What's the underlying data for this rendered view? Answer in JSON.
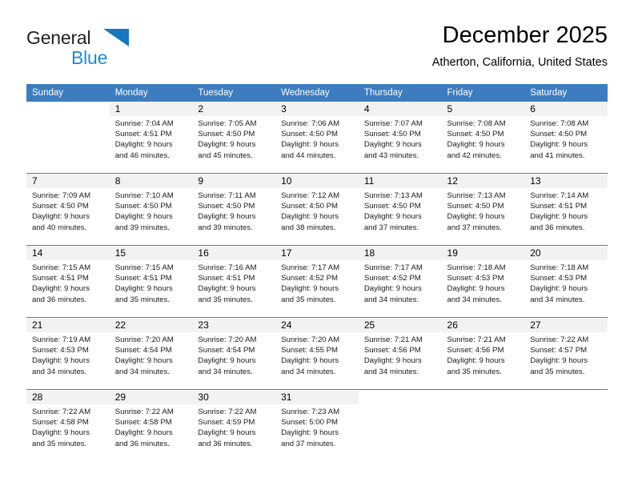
{
  "brand": {
    "line1": "General",
    "line2": "Blue",
    "triangle_color": "#1878bd",
    "text_color": "#231f20",
    "accent_color": "#1f8ad4"
  },
  "header": {
    "title": "December 2025",
    "location": "Atherton, California, United States"
  },
  "theme": {
    "header_row_bg": "#3c7cbf",
    "header_row_text": "#ffffff",
    "daynum_bg": "#f2f2f2",
    "separator": "#3c7cbf"
  },
  "weekday_headers": [
    "Sunday",
    "Monday",
    "Tuesday",
    "Wednesday",
    "Thursday",
    "Friday",
    "Saturday"
  ],
  "weeks": [
    [
      {
        "day": "",
        "sunrise": "",
        "sunset": "",
        "daylight1": "",
        "daylight2": ""
      },
      {
        "day": "1",
        "sunrise": "Sunrise: 7:04 AM",
        "sunset": "Sunset: 4:51 PM",
        "daylight1": "Daylight: 9 hours",
        "daylight2": "and 46 minutes."
      },
      {
        "day": "2",
        "sunrise": "Sunrise: 7:05 AM",
        "sunset": "Sunset: 4:50 PM",
        "daylight1": "Daylight: 9 hours",
        "daylight2": "and 45 minutes."
      },
      {
        "day": "3",
        "sunrise": "Sunrise: 7:06 AM",
        "sunset": "Sunset: 4:50 PM",
        "daylight1": "Daylight: 9 hours",
        "daylight2": "and 44 minutes."
      },
      {
        "day": "4",
        "sunrise": "Sunrise: 7:07 AM",
        "sunset": "Sunset: 4:50 PM",
        "daylight1": "Daylight: 9 hours",
        "daylight2": "and 43 minutes."
      },
      {
        "day": "5",
        "sunrise": "Sunrise: 7:08 AM",
        "sunset": "Sunset: 4:50 PM",
        "daylight1": "Daylight: 9 hours",
        "daylight2": "and 42 minutes."
      },
      {
        "day": "6",
        "sunrise": "Sunrise: 7:08 AM",
        "sunset": "Sunset: 4:50 PM",
        "daylight1": "Daylight: 9 hours",
        "daylight2": "and 41 minutes."
      }
    ],
    [
      {
        "day": "7",
        "sunrise": "Sunrise: 7:09 AM",
        "sunset": "Sunset: 4:50 PM",
        "daylight1": "Daylight: 9 hours",
        "daylight2": "and 40 minutes."
      },
      {
        "day": "8",
        "sunrise": "Sunrise: 7:10 AM",
        "sunset": "Sunset: 4:50 PM",
        "daylight1": "Daylight: 9 hours",
        "daylight2": "and 39 minutes."
      },
      {
        "day": "9",
        "sunrise": "Sunrise: 7:11 AM",
        "sunset": "Sunset: 4:50 PM",
        "daylight1": "Daylight: 9 hours",
        "daylight2": "and 39 minutes."
      },
      {
        "day": "10",
        "sunrise": "Sunrise: 7:12 AM",
        "sunset": "Sunset: 4:50 PM",
        "daylight1": "Daylight: 9 hours",
        "daylight2": "and 38 minutes."
      },
      {
        "day": "11",
        "sunrise": "Sunrise: 7:13 AM",
        "sunset": "Sunset: 4:50 PM",
        "daylight1": "Daylight: 9 hours",
        "daylight2": "and 37 minutes."
      },
      {
        "day": "12",
        "sunrise": "Sunrise: 7:13 AM",
        "sunset": "Sunset: 4:50 PM",
        "daylight1": "Daylight: 9 hours",
        "daylight2": "and 37 minutes."
      },
      {
        "day": "13",
        "sunrise": "Sunrise: 7:14 AM",
        "sunset": "Sunset: 4:51 PM",
        "daylight1": "Daylight: 9 hours",
        "daylight2": "and 36 minutes."
      }
    ],
    [
      {
        "day": "14",
        "sunrise": "Sunrise: 7:15 AM",
        "sunset": "Sunset: 4:51 PM",
        "daylight1": "Daylight: 9 hours",
        "daylight2": "and 36 minutes."
      },
      {
        "day": "15",
        "sunrise": "Sunrise: 7:15 AM",
        "sunset": "Sunset: 4:51 PM",
        "daylight1": "Daylight: 9 hours",
        "daylight2": "and 35 minutes."
      },
      {
        "day": "16",
        "sunrise": "Sunrise: 7:16 AM",
        "sunset": "Sunset: 4:51 PM",
        "daylight1": "Daylight: 9 hours",
        "daylight2": "and 35 minutes."
      },
      {
        "day": "17",
        "sunrise": "Sunrise: 7:17 AM",
        "sunset": "Sunset: 4:52 PM",
        "daylight1": "Daylight: 9 hours",
        "daylight2": "and 35 minutes."
      },
      {
        "day": "18",
        "sunrise": "Sunrise: 7:17 AM",
        "sunset": "Sunset: 4:52 PM",
        "daylight1": "Daylight: 9 hours",
        "daylight2": "and 34 minutes."
      },
      {
        "day": "19",
        "sunrise": "Sunrise: 7:18 AM",
        "sunset": "Sunset: 4:53 PM",
        "daylight1": "Daylight: 9 hours",
        "daylight2": "and 34 minutes."
      },
      {
        "day": "20",
        "sunrise": "Sunrise: 7:18 AM",
        "sunset": "Sunset: 4:53 PM",
        "daylight1": "Daylight: 9 hours",
        "daylight2": "and 34 minutes."
      }
    ],
    [
      {
        "day": "21",
        "sunrise": "Sunrise: 7:19 AM",
        "sunset": "Sunset: 4:53 PM",
        "daylight1": "Daylight: 9 hours",
        "daylight2": "and 34 minutes."
      },
      {
        "day": "22",
        "sunrise": "Sunrise: 7:20 AM",
        "sunset": "Sunset: 4:54 PM",
        "daylight1": "Daylight: 9 hours",
        "daylight2": "and 34 minutes."
      },
      {
        "day": "23",
        "sunrise": "Sunrise: 7:20 AM",
        "sunset": "Sunset: 4:54 PM",
        "daylight1": "Daylight: 9 hours",
        "daylight2": "and 34 minutes."
      },
      {
        "day": "24",
        "sunrise": "Sunrise: 7:20 AM",
        "sunset": "Sunset: 4:55 PM",
        "daylight1": "Daylight: 9 hours",
        "daylight2": "and 34 minutes."
      },
      {
        "day": "25",
        "sunrise": "Sunrise: 7:21 AM",
        "sunset": "Sunset: 4:56 PM",
        "daylight1": "Daylight: 9 hours",
        "daylight2": "and 34 minutes."
      },
      {
        "day": "26",
        "sunrise": "Sunrise: 7:21 AM",
        "sunset": "Sunset: 4:56 PM",
        "daylight1": "Daylight: 9 hours",
        "daylight2": "and 35 minutes."
      },
      {
        "day": "27",
        "sunrise": "Sunrise: 7:22 AM",
        "sunset": "Sunset: 4:57 PM",
        "daylight1": "Daylight: 9 hours",
        "daylight2": "and 35 minutes."
      }
    ],
    [
      {
        "day": "28",
        "sunrise": "Sunrise: 7:22 AM",
        "sunset": "Sunset: 4:58 PM",
        "daylight1": "Daylight: 9 hours",
        "daylight2": "and 35 minutes."
      },
      {
        "day": "29",
        "sunrise": "Sunrise: 7:22 AM",
        "sunset": "Sunset: 4:58 PM",
        "daylight1": "Daylight: 9 hours",
        "daylight2": "and 36 minutes."
      },
      {
        "day": "30",
        "sunrise": "Sunrise: 7:22 AM",
        "sunset": "Sunset: 4:59 PM",
        "daylight1": "Daylight: 9 hours",
        "daylight2": "and 36 minutes."
      },
      {
        "day": "31",
        "sunrise": "Sunrise: 7:23 AM",
        "sunset": "Sunset: 5:00 PM",
        "daylight1": "Daylight: 9 hours",
        "daylight2": "and 37 minutes."
      },
      {
        "day": "",
        "sunrise": "",
        "sunset": "",
        "daylight1": "",
        "daylight2": ""
      },
      {
        "day": "",
        "sunrise": "",
        "sunset": "",
        "daylight1": "",
        "daylight2": ""
      },
      {
        "day": "",
        "sunrise": "",
        "sunset": "",
        "daylight1": "",
        "daylight2": ""
      }
    ]
  ]
}
